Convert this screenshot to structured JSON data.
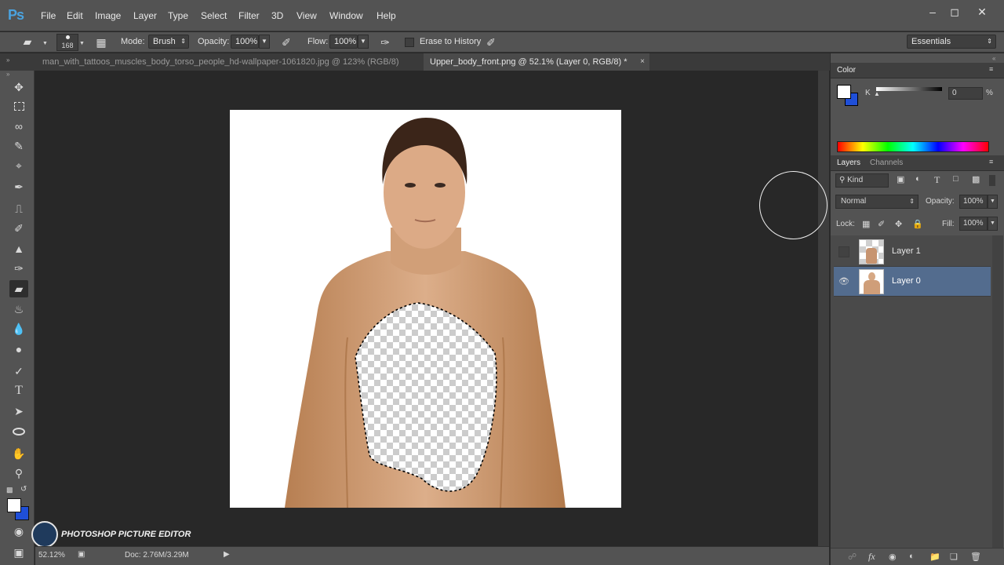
{
  "app": {
    "logo": "Ps",
    "menus": [
      "File",
      "Edit",
      "Image",
      "Layer",
      "Type",
      "Select",
      "Filter",
      "3D",
      "View",
      "Window",
      "Help"
    ],
    "window_controls": [
      "minimize",
      "maximize",
      "close"
    ]
  },
  "options_bar": {
    "brush_size": "168",
    "mode_label": "Mode:",
    "mode_value": "Brush",
    "opacity_label": "Opacity:",
    "opacity_value": "100%",
    "flow_label": "Flow:",
    "flow_value": "100%",
    "erase_to_history_label": "Erase to History",
    "erase_to_history_checked": false,
    "workspace": "Essentials"
  },
  "tabs": [
    {
      "label": "man_with_tattoos_muscles_body_torso_people_hd-wallpaper-1061820.jpg @ 123% (RGB/8)",
      "active": false
    },
    {
      "label": "Upper_body_front.png @ 52.1% (Layer 0, RGB/8) *",
      "active": true
    }
  ],
  "tools": [
    "move-tool",
    "marquee-tool",
    "lasso-tool",
    "quick-selection-tool",
    "crop-tool",
    "eyedropper-tool",
    "spot-healing-tool",
    "brush-tool",
    "clone-stamp-tool",
    "history-brush-tool",
    "eraser-tool",
    "paint-bucket-tool",
    "blur-tool",
    "dodge-tool",
    "pen-tool",
    "type-tool",
    "path-selection-tool",
    "ellipse-tool",
    "hand-tool",
    "zoom-tool"
  ],
  "colors": {
    "foreground": "#ffffff",
    "background": "#1f4fd8",
    "accent_ps": "#4aa3e0",
    "selected_layer": "#536c8e"
  },
  "color_panel": {
    "title": "Color",
    "channel_label": "K",
    "value": "0",
    "unit": "%"
  },
  "layers_panel": {
    "tabs": [
      "Layers",
      "Channels"
    ],
    "filter_kind": "Kind",
    "blend_mode": "Normal",
    "opacity_label": "Opacity:",
    "opacity_value": "100%",
    "lock_label": "Lock:",
    "fill_label": "Fill:",
    "fill_value": "100%",
    "layers": [
      {
        "name": "Layer 1",
        "visible": false,
        "selected": false
      },
      {
        "name": "Layer 0",
        "visible": true,
        "selected": true
      }
    ]
  },
  "status": {
    "zoom": "52.12%",
    "doc": "Doc: 2.76M/3.29M"
  },
  "watermark": "PHOTOSHOP PICTURE EDITOR"
}
